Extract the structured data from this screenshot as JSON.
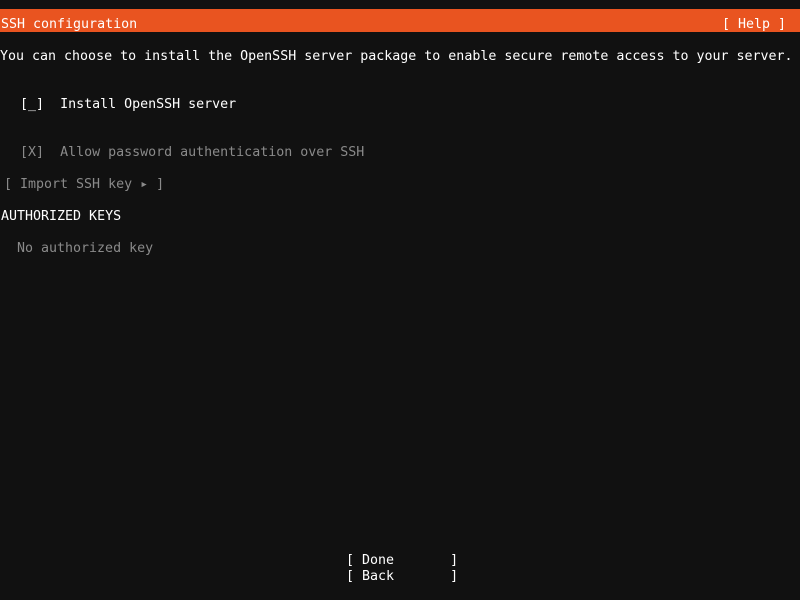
{
  "header": {
    "title": "SSH configuration",
    "help_label": "[ Help ]"
  },
  "description": "You can choose to install the OpenSSH server package to enable secure remote access to your server.",
  "install_openssh": {
    "checkbox": "[_]",
    "label": "Install OpenSSH server"
  },
  "password_auth": {
    "checkbox": "[X]",
    "label": "Allow password authentication over SSH"
  },
  "import_key_button": "[ Import SSH key ▸ ]",
  "authorized_keys": {
    "heading": "AUTHORIZED KEYS",
    "empty_text": "No authorized key"
  },
  "buttons": {
    "done": "[ Done       ]",
    "back": "[ Back       ]"
  },
  "colors": {
    "header_bg": "#e95420",
    "background": "#111111",
    "text": "#ffffff",
    "disabled_text": "#8a8a8a"
  }
}
